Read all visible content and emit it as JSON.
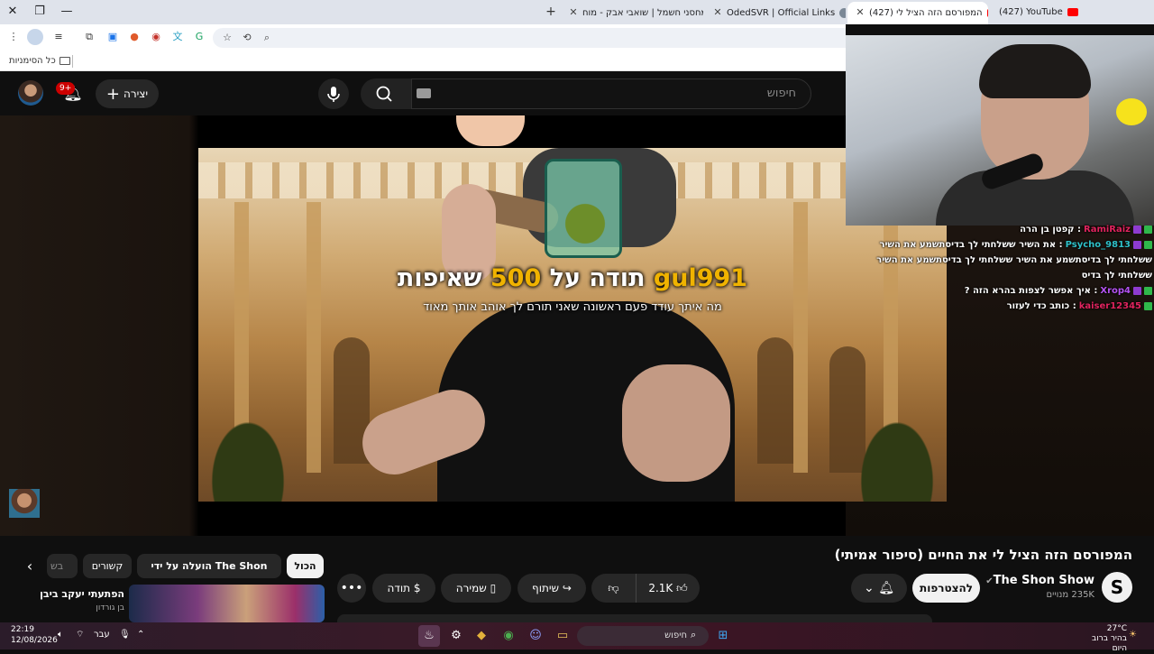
{
  "browser": {
    "tabs": [
      {
        "title": "(427) YouTube",
        "favicon": "youtube-icon",
        "active": false
      },
      {
        "title": "(427) המפורסם הזה הציל לי",
        "favicon": "youtube-icon",
        "active": true
      },
      {
        "title": "OdedSVR | Official Links",
        "favicon": "avatar-icon",
        "active": false
      },
      {
        "title": "מחסני חשמל | שואבי אבק - מוח",
        "favicon": "store-icon",
        "active": false
      }
    ],
    "bookmarks_folder": "כל הסימניות"
  },
  "youtube": {
    "search_placeholder": "חיפוש",
    "create_label": "יצירה",
    "notification_count": "9+",
    "video": {
      "donation_user": "gul991",
      "donation_thanks": "תודה על",
      "donation_amount": "500",
      "donation_unit": "שאיפות",
      "donation_message": "מה איתך עודד פעם ראשונה שאני תורם לך אוהב אותך מאוד"
    },
    "title": "המפורסם הזה הציל לי את החיים (סיפור אמיתי)",
    "channel": {
      "name": "The Shon Show",
      "subscribers": "235K מנויים",
      "logo_letter": "S"
    },
    "subscribe_label": "להצטרפות",
    "like_count": "2.1K",
    "share_label": "שיתוף",
    "save_label": "שמירה",
    "thanks_label": "תודה",
    "chips": {
      "all": "הכול",
      "uploaded_by": "הועלה על ידי The Shon Show",
      "related": "קשורים",
      "partial": "בש"
    },
    "recommendation": {
      "title": "הפתעתי יעקב ביבן",
      "author": "בן גורדון"
    }
  },
  "chat": [
    {
      "user": "RamiRaiz",
      "badges": [
        "k",
        "m"
      ],
      "message": "קפטן בן הרה"
    },
    {
      "user": "Psycho_9813",
      "badges": [
        "k",
        "m"
      ],
      "message": "את השיר ששלחתי לך בדיסתשמע את השיר ששלחתי לך בדיסתשמע את השיר ששלחתי לך בדיסתשמע את השיר ששלחתי לך בדיס"
    },
    {
      "user": "Xrop4",
      "badges": [
        "k",
        "m"
      ],
      "message": "איך אפשר לצפות בהרא הזה ?"
    },
    {
      "user": "kaiser12345",
      "badges": [
        "k"
      ],
      "message": "כותב כדי לעזור"
    }
  ],
  "taskbar": {
    "time": "22:19",
    "date": "12/08/2026",
    "language": "עבר",
    "search_placeholder": "חיפוש",
    "weather_temp": "27°C",
    "weather_desc": "בהיר ברוב היום"
  },
  "colors": {
    "accent_gold": "#f0b300",
    "yt_red": "#ff0000"
  }
}
